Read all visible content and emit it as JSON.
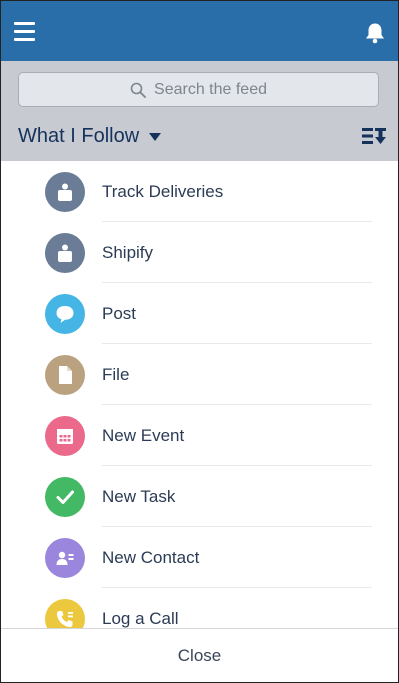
{
  "topbar": {
    "menu_icon": "hamburger-menu-icon",
    "notification_icon": "bell-icon",
    "background": "#2a6ea9"
  },
  "search": {
    "placeholder": "Search the feed",
    "icon": "search-icon"
  },
  "feed_filter": {
    "label": "What I Follow",
    "icon": "caret-down-icon"
  },
  "sort_icon": "sort-lines-icon",
  "actions": [
    {
      "label": "Track Deliveries",
      "icon": "custom-app-icon",
      "color": "#6a7c96"
    },
    {
      "label": "Shipify",
      "icon": "custom-app-icon",
      "color": "#6a7c96"
    },
    {
      "label": "Post",
      "icon": "chat-bubble-icon",
      "color": "#44b5e4"
    },
    {
      "label": "File",
      "icon": "file-icon",
      "color": "#baa17f"
    },
    {
      "label": "New Event",
      "icon": "calendar-icon",
      "color": "#eb6a8b"
    },
    {
      "label": "New Task",
      "icon": "checkmark-icon",
      "color": "#44b965"
    },
    {
      "label": "New Contact",
      "icon": "contact-card-icon",
      "color": "#9b86de"
    },
    {
      "label": "Log a Call",
      "icon": "phone-icon",
      "color": "#ecc83e"
    }
  ],
  "footer": {
    "close_label": "Close"
  }
}
